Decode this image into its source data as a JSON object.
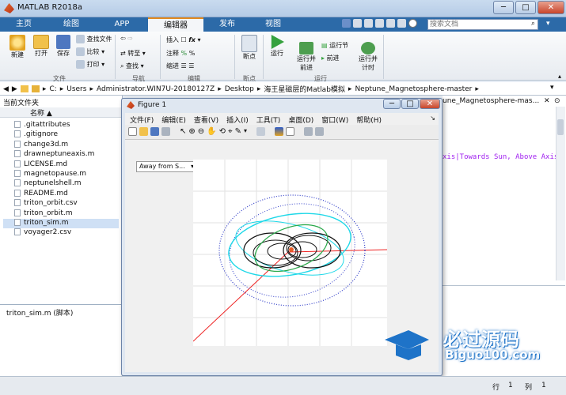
{
  "window": {
    "title": "MATLAB R2018a",
    "min": "─",
    "max": "□",
    "close": "✕"
  },
  "tabs": [
    "主页",
    "绘图",
    "APP",
    "编辑器",
    "发布",
    "视图"
  ],
  "search": {
    "placeholder": "搜索文档"
  },
  "ribbon": {
    "file": {
      "new": "新建",
      "open": "打开",
      "save": "保存",
      "find_files": "查找文件",
      "compare": "比较",
      "print": "打印",
      "group": "文件"
    },
    "nav": {
      "goto": "转至",
      "find": "查找",
      "group": "导航"
    },
    "edit": {
      "insert": "插入",
      "comment": "注释",
      "indent": "缩进",
      "group": "编辑"
    },
    "bp": {
      "breakpoints": "断点",
      "group": "断点"
    },
    "run": {
      "run": "运行",
      "run_advance": "运行并\n前进",
      "run_section": "运行节",
      "advance": "前进",
      "run_time": "运行并\n计时",
      "group": "运行"
    }
  },
  "address": {
    "parts": [
      "C:",
      "Users",
      "Administrator.WIN7U-20180127Z",
      "Desktop",
      "海王星磁层的Matlab模拟",
      "Neptune_Magnetosphere-master"
    ]
  },
  "left": {
    "title": "当前文件夹",
    "col": "名称 ▲",
    "files": [
      ".gitattributes",
      ".gitignore",
      "change3d.m",
      "drawneptuneaxis.m",
      "LICENSE.md",
      "magnetopause.m",
      "neptunelshell.m",
      "README.md",
      "triton_orbit.csv",
      "triton_orbit.m",
      "triton_sim.m",
      "voyager2.csv"
    ],
    "selected": "triton_sim.m",
    "detail": "triton_sim.m  (脚本)"
  },
  "figure": {
    "title": "Figure 1",
    "menu": [
      "文件(F)",
      "编辑(E)",
      "查看(V)",
      "插入(I)",
      "工具(T)",
      "桌面(D)",
      "窗口(W)",
      "帮助(H)"
    ],
    "dropdown": "Away from S..."
  },
  "right": {
    "title": "une_Magnetosphere-mas...",
    "code": "xis|Towards Sun, Above Axis"
  },
  "status": {
    "row_label": "行",
    "row": "1",
    "col_label": "列",
    "col": "1"
  },
  "watermark": {
    "cn": "必过源码",
    "en": "Biguo100.com"
  }
}
